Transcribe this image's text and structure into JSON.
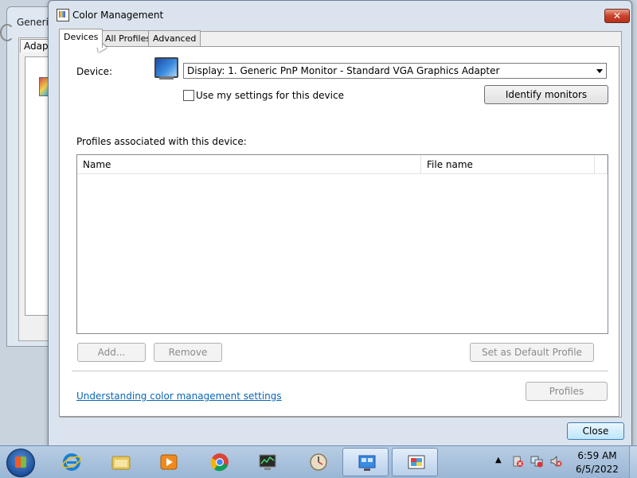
{
  "background_window": {
    "title": "Generic",
    "tab": "Adapt"
  },
  "window": {
    "title": "Color Management",
    "close_symbol": "✕"
  },
  "tabs": [
    {
      "label": "Devices"
    },
    {
      "label": "All Profiles"
    },
    {
      "label": "Advanced"
    }
  ],
  "devices": {
    "device_label": "Device:",
    "device_value": "Display: 1. Generic PnP Monitor - Standard VGA Graphics Adapter",
    "use_settings_label": "Use my settings for this device",
    "use_settings_checked": false,
    "identify_button": "Identify monitors",
    "profiles_label": "Profiles associated with this device:",
    "table_headers": [
      "Name",
      "File name"
    ],
    "rows": [],
    "add_button": "Add...",
    "remove_button": "Remove",
    "default_button": "Set as Default Profile",
    "help_link": "Understanding color management settings",
    "profiles_button": "Profiles"
  },
  "footer": {
    "close_button": "Close"
  },
  "taskbar": {
    "items": [
      "ie-icon",
      "explorer-icon",
      "media-player-icon",
      "chrome-icon",
      "task-manager-icon",
      "clock-app-icon",
      "display-settings-icon",
      "color-management-icon"
    ],
    "time": "6:59 AM",
    "date": "6/5/2022"
  }
}
